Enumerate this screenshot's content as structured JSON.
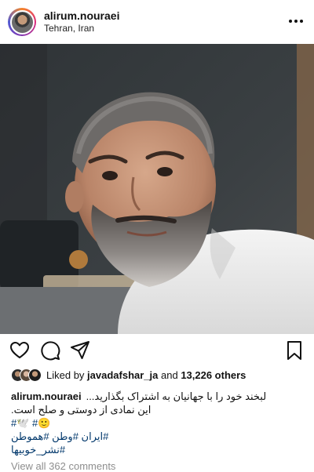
{
  "post": {
    "username": "alirum.nouraei",
    "location": "Tehran, Iran"
  },
  "icons": {
    "like": "heart-icon",
    "comment": "comment-icon",
    "share": "paper-plane-icon",
    "save": "bookmark-icon",
    "more": "more-dots-icon"
  },
  "likes": {
    "prefix": "Liked by ",
    "user": "javadafshar_ja",
    "middle": " and ",
    "count": "13,226 others"
  },
  "caption": {
    "username": "alirum.nouraei",
    "line1": "لبخند خود را با جهانیان به اشتراک بگذارید...",
    "line2": "این نمادی از دوستی و صلح است.",
    "line3": "#🕊️ #🙂",
    "line4": "#ایران #وطن #هموطن",
    "line5": "#نشر_خوبیها"
  },
  "comments": {
    "view_all": "View all 362 comments"
  },
  "colors": {
    "hashtag": "#00376b",
    "muted": "#8e8e8e"
  }
}
